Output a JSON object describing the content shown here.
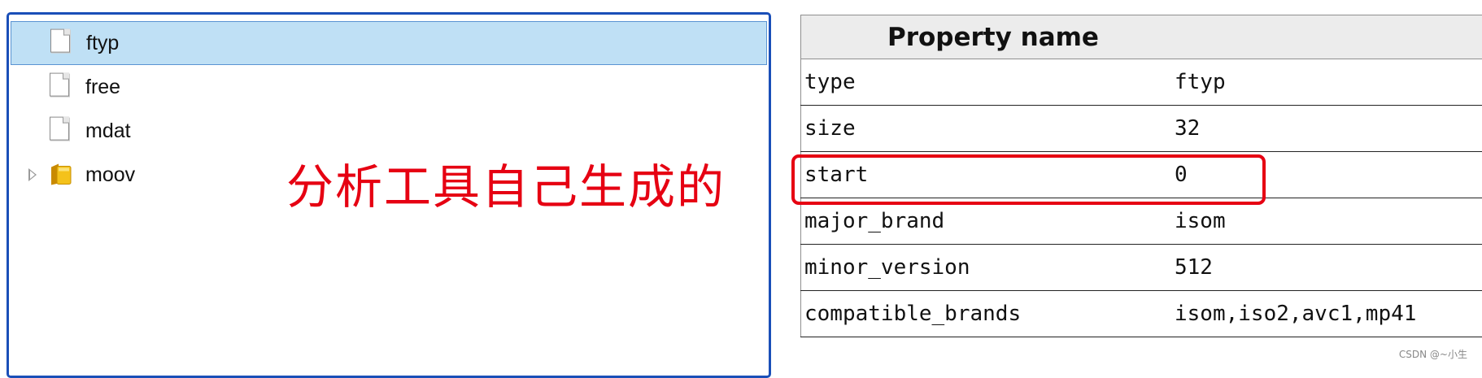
{
  "tree": {
    "items": [
      {
        "label": "ftyp",
        "icon": "file-icon",
        "selected": true
      },
      {
        "label": "free",
        "icon": "file-icon",
        "selected": false
      },
      {
        "label": "mdat",
        "icon": "file-icon",
        "selected": false
      },
      {
        "label": "moov",
        "icon": "folder-icon",
        "selected": false,
        "expandable": true
      }
    ]
  },
  "annotation": "分析工具自己生成的",
  "table": {
    "header": "Property name",
    "rows": [
      {
        "key": "type",
        "value": "ftyp"
      },
      {
        "key": "size",
        "value": "32"
      },
      {
        "key": "start",
        "value": "0"
      },
      {
        "key": "major_brand",
        "value": "isom"
      },
      {
        "key": "minor_version",
        "value": "512"
      },
      {
        "key": "compatible_brands",
        "value": "isom,iso2,avc1,mp41"
      }
    ]
  },
  "watermark": "CSDN @~小生",
  "colors": {
    "accent_red": "#e60012",
    "selection": "#bfe0f5",
    "panel_border": "#1a4fb8"
  }
}
